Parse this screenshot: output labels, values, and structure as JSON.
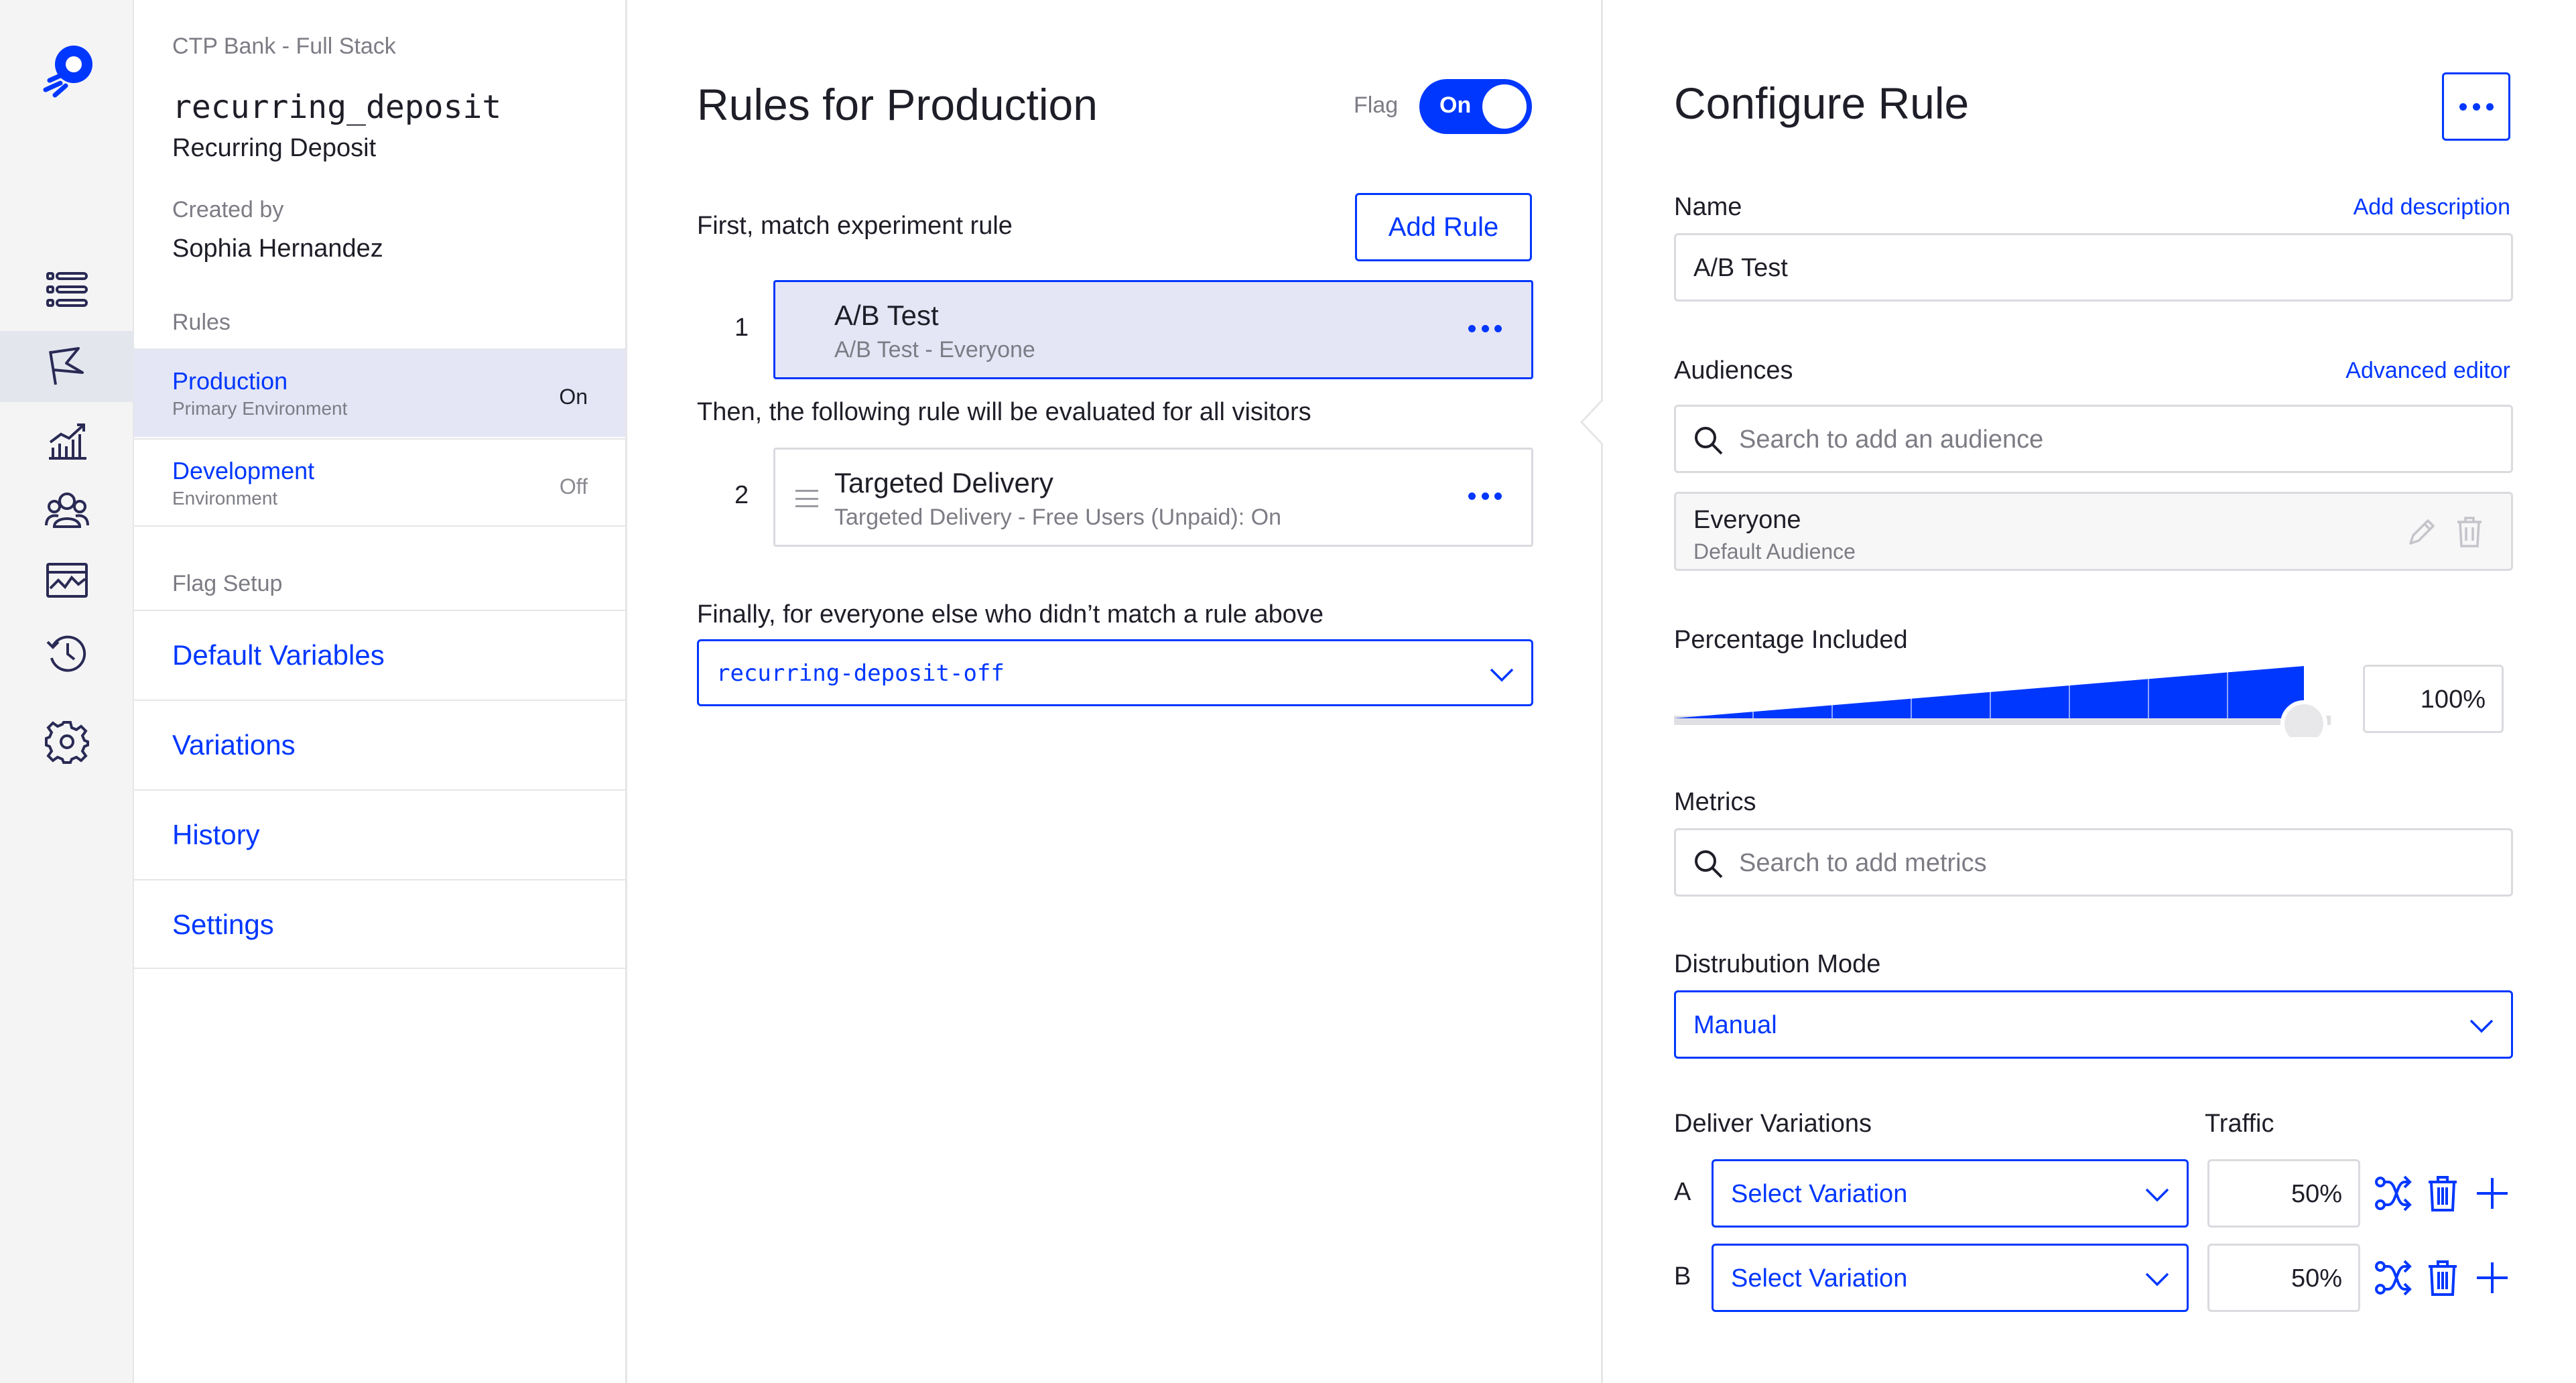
{
  "nav": {
    "items": [
      "flags-list",
      "flag",
      "reports",
      "audiences",
      "events",
      "history",
      "settings"
    ],
    "active": "flag"
  },
  "flag": {
    "project": "CTP Bank - Full Stack",
    "key": "recurring_deposit",
    "name": "Recurring Deposit",
    "created_by_label": "Created by",
    "created_by": "Sophia Hernandez",
    "rules_label": "Rules",
    "environments": [
      {
        "name": "Production",
        "sub": "Primary Environment",
        "state": "On"
      },
      {
        "name": "Development",
        "sub": "Environment",
        "state": "Off"
      }
    ],
    "setup_label": "Flag Setup",
    "setup_links": [
      "Default Variables",
      "Variations",
      "History",
      "Settings"
    ]
  },
  "rules": {
    "title": "Rules for Production",
    "flag_label": "Flag",
    "flag_toggle": "On",
    "first_label": "First, match experiment rule",
    "add_rule": "Add Rule",
    "items": [
      {
        "num": "1",
        "title": "A/B Test",
        "sub": "A/B Test - Everyone"
      },
      {
        "num": "2",
        "title": "Targeted Delivery",
        "sub": "Targeted Delivery - Free Users (Unpaid): On"
      }
    ],
    "then_label": "Then, the following rule will be evaluated for all visitors",
    "finally_label": "Finally, for everyone else who didn’t match a rule above",
    "fallback": "recurring-deposit-off"
  },
  "config": {
    "title": "Configure Rule",
    "name_label": "Name",
    "add_description": "Add description",
    "name_value": "A/B Test",
    "audiences_label": "Audiences",
    "advanced_editor": "Advanced editor",
    "audience_placeholder": "Search to add an audience",
    "audience": {
      "name": "Everyone",
      "sub": "Default Audience"
    },
    "percentage_label": "Percentage Included",
    "percentage_value": "100%",
    "percentage_fraction": 1.0,
    "metrics_label": "Metrics",
    "metrics_placeholder": "Search to add metrics",
    "distribution_label": "Distrubution Mode",
    "distribution_value": "Manual",
    "deliver_label": "Deliver Variations",
    "traffic_label": "Traffic",
    "variations": [
      {
        "letter": "A",
        "select": "Select Variation",
        "traffic": "50%"
      },
      {
        "letter": "B",
        "select": "Select Variation",
        "traffic": "50%"
      }
    ]
  },
  "colors": {
    "accent": "#0037ff",
    "selected_bg": "#e4e6f5",
    "muted": "#7c7c85",
    "border": "#dadadf"
  }
}
